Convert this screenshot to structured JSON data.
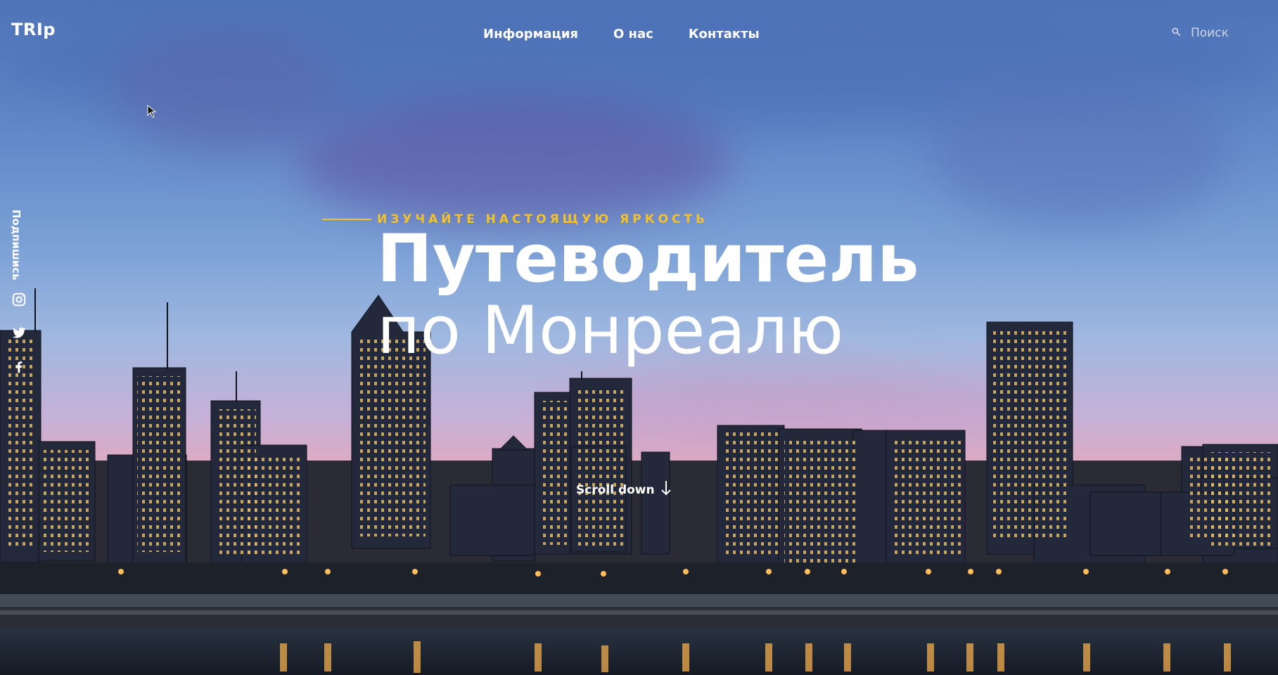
{
  "app": {
    "logo": "TRIp"
  },
  "nav": {
    "items": [
      {
        "label": "Информация"
      },
      {
        "label": "О нас"
      },
      {
        "label": "Контакты"
      }
    ]
  },
  "search": {
    "placeholder": "Поиск",
    "icon": "search-icon"
  },
  "social": {
    "subscribe_label": "Подпишись",
    "icons": [
      "instagram-icon",
      "twitter-icon",
      "facebook-icon"
    ]
  },
  "hero": {
    "eyebrow": "ИЗУЧАЙТЕ НАСТОЯЩУЮ ЯРКОСТЬ",
    "title_line1": "Путеводитель",
    "title_line2": "по Монреалю",
    "scroll_label": "Scroll down",
    "accent_color": "#f2c12b"
  }
}
